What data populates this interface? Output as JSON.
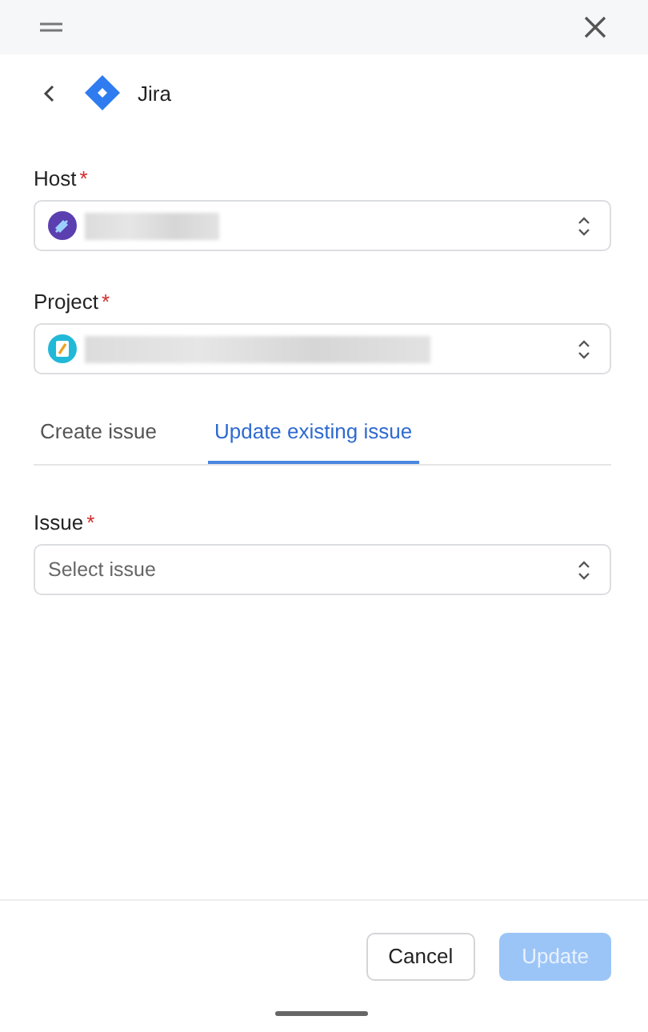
{
  "header": {
    "title": "Jira"
  },
  "fields": [
    {
      "label": "Host",
      "required_mark": "*",
      "kind": "select"
    },
    {
      "label": "Project",
      "required_mark": "*",
      "kind": "select"
    }
  ],
  "tabs": [
    {
      "label": "Create issue",
      "selected": false
    },
    {
      "label": "Update existing issue",
      "selected": true
    }
  ],
  "issue_field": {
    "label": "Issue",
    "required_mark": "*",
    "placeholder": "Select issue"
  },
  "buttons": [
    {
      "label": "Cancel",
      "kind": "secondary",
      "disabled": false
    },
    {
      "label": "Update",
      "kind": "primary",
      "disabled": true
    }
  ]
}
